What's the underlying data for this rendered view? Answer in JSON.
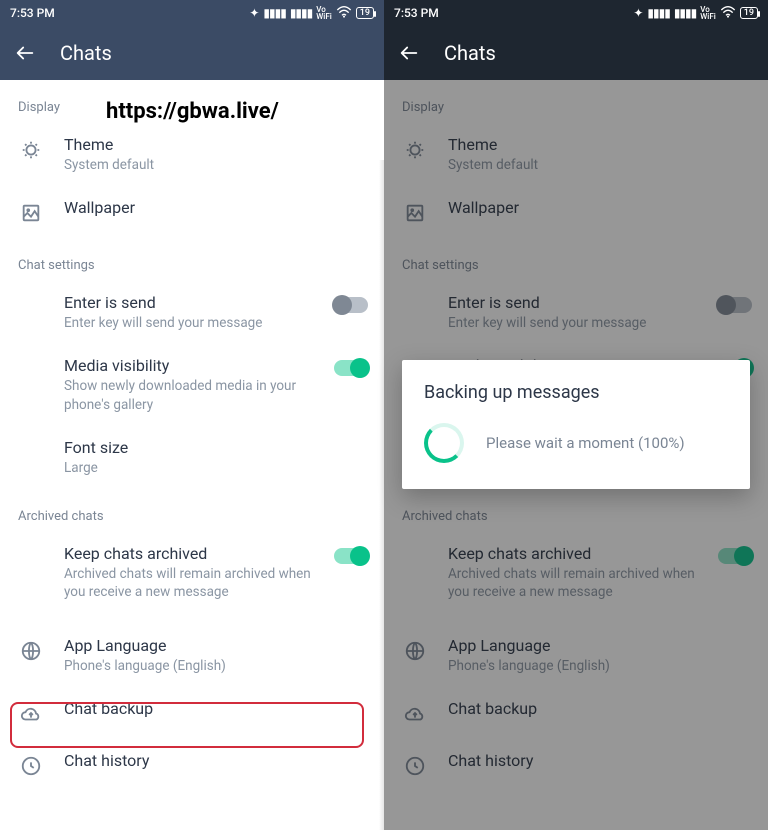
{
  "status": {
    "time": "7:53 PM",
    "battery": "19",
    "vo_top": "Vo",
    "vo_bot": "WiFi"
  },
  "header": {
    "title": "Chats"
  },
  "watermark": "https://gbwa.live/",
  "sections": {
    "display": "Display",
    "chat_settings": "Chat settings",
    "archived": "Archived chats"
  },
  "rows": {
    "theme": {
      "title": "Theme",
      "sub": "System default"
    },
    "wallpaper": {
      "title": "Wallpaper"
    },
    "enter_send": {
      "title": "Enter is send",
      "sub": "Enter key will send your message"
    },
    "media_vis": {
      "title": "Media visibility",
      "sub": "Show newly downloaded media in your phone's gallery"
    },
    "font_size": {
      "title": "Font size",
      "sub": "Large"
    },
    "keep_arch": {
      "title": "Keep chats archived",
      "sub": "Archived chats will remain archived when you receive a new message"
    },
    "app_lang": {
      "title": "App Language",
      "sub": "Phone's language (English)"
    },
    "chat_backup": {
      "title": "Chat backup"
    },
    "chat_history": {
      "title": "Chat history"
    }
  },
  "dialog": {
    "title": "Backing up messages",
    "text": "Please wait a moment (100%)"
  }
}
